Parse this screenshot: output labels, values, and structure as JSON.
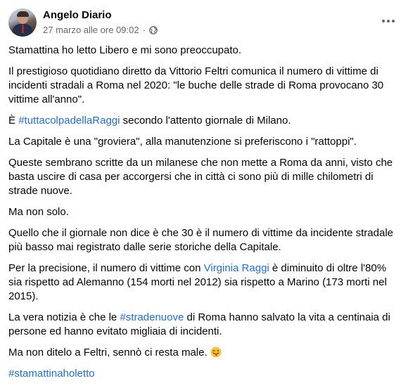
{
  "post": {
    "author": "Angelo Diario",
    "timestamp": "27 marzo alle ore 09:02",
    "separator": "·",
    "privacy_icon": "globe-icon",
    "more_icon": "more-options-icon",
    "paragraphs": {
      "p1": "Stamattina ho letto Libero e mi sono preoccupato.",
      "p2": "Il prestigioso quotidiano diretto da Vittorio Feltri comunica il numero di vittime di incidenti stradali a Roma nel 2020: \"le buche delle strade di Roma provocano 30 vittime all'anno\".",
      "p3_prefix": "È ",
      "p3_hashtag": "#tuttacolpadellaRaggi",
      "p3_suffix": " secondo l'attento giornale di Milano.",
      "p4": "La Capitale è una \"groviera\", alla manutenzione si preferiscono i \"rattoppi\".",
      "p5": "Queste sembrano scritte da un milanese che non mette a Roma da anni, visto che basta uscire di casa per accorgersi che in città ci sono più di mille chilometri di strade nuove.",
      "p6": "Ma non solo.",
      "p7": "Quello che il giornale non dice è che 30 è il numero di vittime da incidente stradale più basso mai registrato dalle serie storiche della Capitale.",
      "p8_prefix": "Per la precisione, il numero di vittime con ",
      "p8_mention": "Virginia Raggi",
      "p8_suffix": " è diminuito di oltre l'80% sia rispetto ad Alemanno (154 morti nel 2012) sia rispetto a Marino (173 morti nel 2015).",
      "p9_prefix": "La vera notizia è che le ",
      "p9_hashtag": "#stradenuove",
      "p9_suffix": " di Roma hanno salvato la vita a centinaia di persone ed hanno evitato migliaia di incidenti.",
      "p10": "Ma non ditelo a Feltri, sennò ci resta male. ",
      "p10_emoji": "winking-tongue-emoji",
      "p11_hashtag": "#stamattinaholetto"
    }
  },
  "colors": {
    "link": "#216fdb",
    "meta": "#65676b",
    "text": "#050505"
  }
}
